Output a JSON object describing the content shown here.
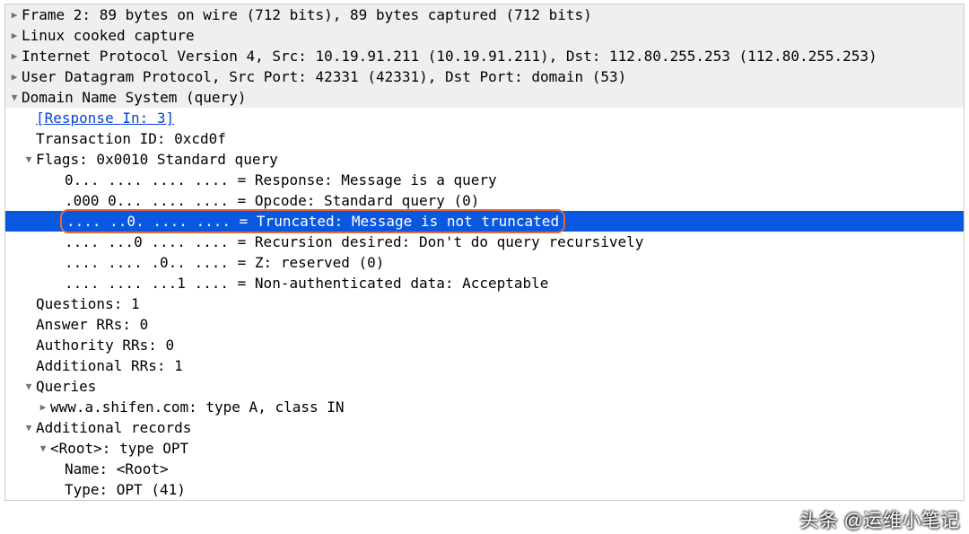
{
  "headers": {
    "frame": "Frame 2: 89 bytes on wire (712 bits), 89 bytes captured (712 bits)",
    "linux": "Linux cooked capture",
    "ip": "Internet Protocol Version 4, Src: 10.19.91.211 (10.19.91.211), Dst: 112.80.255.253 (112.80.255.253)",
    "udp": "User Datagram Protocol, Src Port: 42331 (42331), Dst Port: domain (53)",
    "dns": "Domain Name System (query)"
  },
  "dns": {
    "response_in": "[Response In: 3]",
    "txid": "Transaction ID: 0xcd0f",
    "flags_label": "Flags: 0x0010 Standard query",
    "flags": {
      "response": "0... .... .... .... = Response: Message is a query",
      "opcode": ".000 0... .... .... = Opcode: Standard query (0)",
      "truncated": ".... ..0. .... .... = Truncated: Message is not truncated",
      "rd": ".... ...0 .... .... = Recursion desired: Don't do query recursively",
      "z": ".... .... .0.. .... = Z: reserved (0)",
      "ad": ".... .... ...1 .... = Non-authenticated data: Acceptable"
    },
    "questions": "Questions: 1",
    "answer_rrs": "Answer RRs: 0",
    "authority_rrs": "Authority RRs: 0",
    "additional_rrs": "Additional RRs: 1",
    "queries_label": "Queries",
    "query0": "www.a.shifen.com: type A, class IN",
    "addl_label": "Additional records",
    "root_label": "<Root>: type OPT",
    "root_name": "Name: <Root>",
    "root_type": "Type: OPT (41)"
  },
  "watermark": "头条 @运维小笔记"
}
